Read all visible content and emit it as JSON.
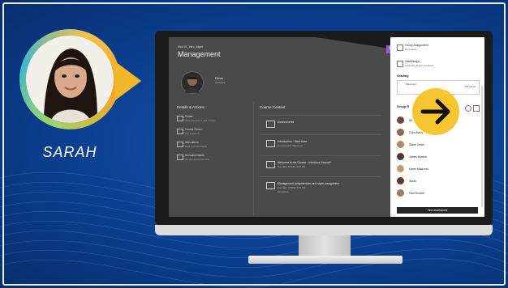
{
  "presenter": {
    "name": "SARAH"
  },
  "course": {
    "code": "Mod 01_Intro_Mgmt",
    "title": "Management",
    "instructor_name": "Omar",
    "instructor_role": "Instructor"
  },
  "details_actions": {
    "heading": "Details & Actions",
    "items": [
      {
        "label": "Roster",
        "sub": "View everyone in your course"
      },
      {
        "label": "Course Room",
        "sub": "Join session ▾"
      },
      {
        "label": "Attendance",
        "sub": "Mark your attendance"
      },
      {
        "label": "Announcements",
        "sub": "No new announcements"
      }
    ]
  },
  "course_content": {
    "heading": "Course Content",
    "items": [
      {
        "title": "Assessments",
        "sub": ""
      },
      {
        "title": "Introduction - Start Here",
        "sub": "Overview and Objectives"
      },
      {
        "title": "Welcome to the Course - Introduce Yourself",
        "sub": "Due date: 5/11/18, 3:37 PM"
      },
      {
        "title": "Management competencies and styles assignment",
        "sub": "Due date: 7/19/18, 6:00 PM"
      },
      {
        "title": "",
        "sub": "Persuasive"
      }
    ]
  },
  "panel": {
    "group_assignment_title": "Group Assignment",
    "group_assignment_sub": "Persuasive",
    "safeassign_title": "SafeAssign",
    "safeassign_sub": "Originality Report enabled",
    "grading_label": "Grading",
    "grading_value": "Maximum",
    "points": "100 points",
    "group_label": "Group R",
    "view_button": "View assessment",
    "members": [
      {
        "name": "Ali",
        "color": "#6b4a3a"
      },
      {
        "name": "Colin Avery",
        "color": "#8a6a55"
      },
      {
        "name": "Diane Lewis",
        "color": "#b08a6a"
      },
      {
        "name": "James Watson",
        "color": "#4a3a30"
      },
      {
        "name": "Karen MacLeod",
        "color": "#c49a7a"
      },
      {
        "name": "Sarah",
        "color": "#5a3a2c"
      },
      {
        "name": "Paul Russell",
        "color": "#9a7a62"
      }
    ]
  },
  "colors": {
    "background": "#0b3f8f",
    "accent_yellow": "#f7c52f",
    "accent_purple": "#9b59d6"
  },
  "icons": {
    "close": "×",
    "arrow": "arrow-right-icon"
  }
}
